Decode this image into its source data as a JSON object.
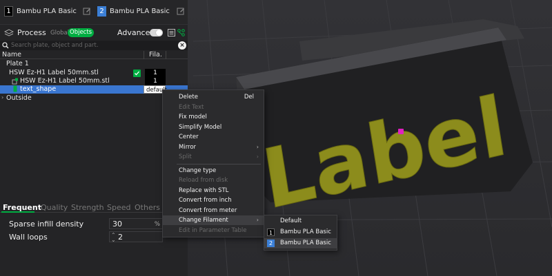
{
  "filaments": [
    {
      "num": "1",
      "name": "Bambu PLA Basic",
      "color": "#000000"
    },
    {
      "num": "2",
      "name": "Bambu PLA Basic",
      "color": "#3b7fd6"
    }
  ],
  "process": {
    "title": "Process",
    "global_label": "Global",
    "objects_label": "Objects",
    "advanced_label": "Advanced",
    "advanced_on": true,
    "search_placeholder": "Search plate, object and part."
  },
  "tree": {
    "col_name": "Name",
    "col_fila": "Fila.",
    "rows": [
      {
        "label": "Plate 1"
      },
      {
        "label": "HSW Ez-H1 Label 50mm.stl",
        "filament": "1"
      },
      {
        "label": "HSW Ez-H1 Label 50mm.stl",
        "filament": "1"
      },
      {
        "label": "text_shape",
        "filament": "default"
      },
      {
        "label": "Outside"
      }
    ]
  },
  "tabs": [
    "Frequent",
    "Quality",
    "Strength",
    "Speed",
    "Others"
  ],
  "params": [
    {
      "label": "Sparse infill density",
      "value": "30",
      "unit": "%"
    },
    {
      "label": "Wall loops",
      "value": "2"
    }
  ],
  "context_menu": {
    "items": [
      {
        "label": "Delete",
        "shortcut": "Del"
      },
      {
        "label": "Edit Text",
        "disabled": true
      },
      {
        "label": "Fix model"
      },
      {
        "label": "Simplify Model"
      },
      {
        "label": "Center"
      },
      {
        "label": "Mirror",
        "submenu": true
      },
      {
        "label": "Split",
        "disabled": true,
        "submenu": true
      },
      {
        "label": "Change type"
      },
      {
        "label": "Reload from disk",
        "disabled": true
      },
      {
        "label": "Replace with STL"
      },
      {
        "label": "Convert from inch"
      },
      {
        "label": "Convert from meter"
      },
      {
        "label": "Change Filament",
        "submenu": true
      },
      {
        "label": "Edit in Parameter Table",
        "disabled": true
      }
    ],
    "submenu_marker": "›"
  },
  "filament_submenu": {
    "items": [
      {
        "label": "Default"
      },
      {
        "num": "1",
        "label": "Bambu PLA Basic",
        "color": "#000000"
      },
      {
        "num": "2",
        "label": "Bambu PLA Basic",
        "color": "#3b7fd6"
      }
    ]
  },
  "viewport": {
    "model_text": "Label",
    "model_text_color": "#8c8c1c",
    "accent": "#00ae42"
  }
}
